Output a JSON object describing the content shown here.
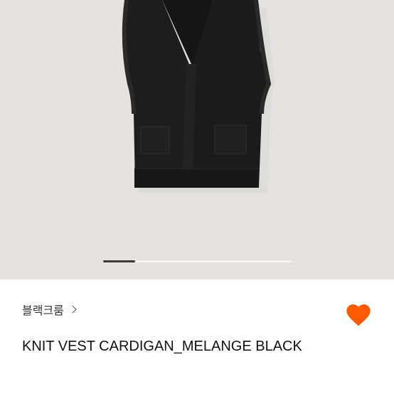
{
  "product": {
    "image_alt": "black knit vest cardigan",
    "carousel": {
      "current": 1,
      "active_fraction": 0.17
    },
    "brand": "블랙크룸",
    "title": "KNIT VEST CARDIGAN_MELANGE BLACK",
    "like_color": "#ff5a00"
  },
  "colors": {
    "background": "#e4e3e1",
    "garment": "#1c1c1c"
  }
}
